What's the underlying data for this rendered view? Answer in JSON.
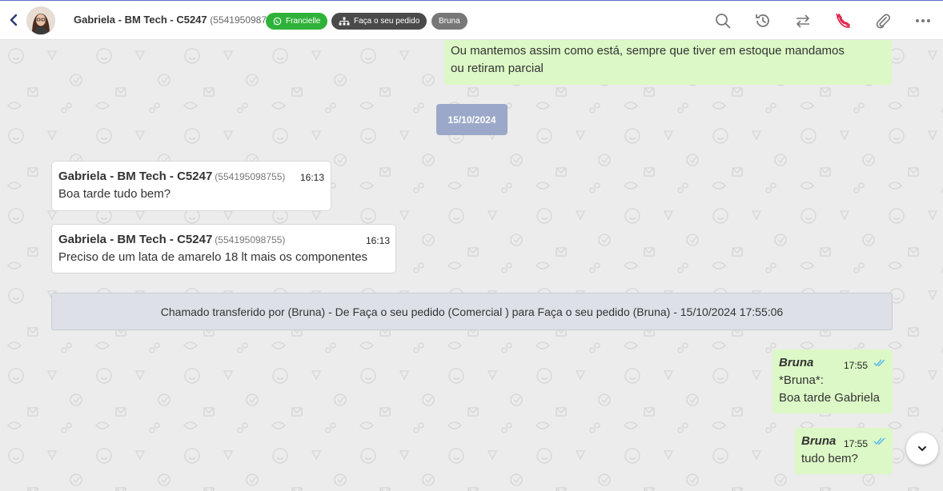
{
  "header": {
    "contact_name": "Gabriela - BM Tech - C5247",
    "contact_phone": "(554195098755)",
    "tags": [
      {
        "label": "Francielle",
        "icon": "whatsapp-icon",
        "color": "#2fb23a"
      },
      {
        "label": "Faça o seu pedido",
        "icon": "sitemap-icon",
        "color": "#4a4a4a"
      },
      {
        "label": "Bruna",
        "color": "#777777"
      }
    ],
    "accent_color": "#5b6dcd"
  },
  "chat": {
    "top_message": {
      "text_line1": "Ou mantemos assim como está, sempre que tiver em estoque mandamos",
      "text_line2": "ou retiram parcial"
    },
    "date_separator": "15/10/2024",
    "incoming": [
      {
        "sender": "Gabriela - BM Tech - C5247",
        "phone": "(554195098755)",
        "time": "16:13",
        "text": "Boa tarde tudo bem?"
      },
      {
        "sender": "Gabriela - BM Tech - C5247",
        "phone": "(554195098755)",
        "time": "16:13",
        "text": "Preciso de um lata de amarelo 18 lt mais os componentes"
      }
    ],
    "system_message": "Chamado transferido por (Bruna) - De Faça o seu pedido (Comercial ) para Faça o seu pedido (Bruna) - 15/10/2024 17:55:06",
    "outgoing": [
      {
        "sender": "Bruna",
        "time": "17:55",
        "line1": "*Bruna*:",
        "line2": "Boa tarde Gabriela"
      },
      {
        "sender": "Bruna",
        "time": "17:55",
        "line1": "tudo bem?"
      }
    ],
    "bubble_colors": {
      "outgoing": "#dcf8c6",
      "incoming": "#ffffff",
      "date": "#9ba8c9"
    }
  }
}
